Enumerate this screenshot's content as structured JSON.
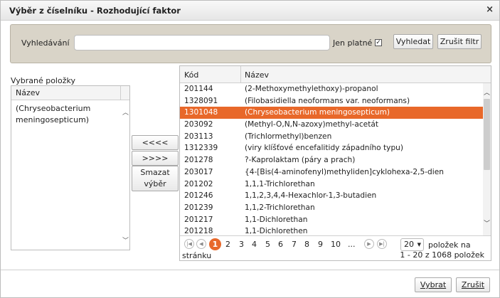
{
  "dialog": {
    "title": "Výběr z číselníku - Rozhodující faktor",
    "close_glyph": "×"
  },
  "search": {
    "label": "Vyhledávání",
    "value": "",
    "placeholder": "",
    "only_valid_label": "Jen platné",
    "only_valid_checked": true,
    "check_glyph": "✓",
    "search_button": "Vyhledat",
    "clear_button": "Zrušit filtr"
  },
  "selected": {
    "label": "Vybrané položky",
    "column_header": "Název",
    "items": [
      "(Chryseobacterium meningosepticum)"
    ]
  },
  "actions": {
    "add_all": "<<<<",
    "remove": ">>>>",
    "clear_selection_line1": "Smazat",
    "clear_selection_line2": "výběr"
  },
  "grid": {
    "columns": [
      "Kód",
      "Název"
    ],
    "selected_row_index": 2,
    "rows": [
      {
        "code": "201144",
        "name": "(2-Methoxymethylethoxy)-propanol"
      },
      {
        "code": "1328091",
        "name": "(Filobasidiella neoformans var. neoformans)"
      },
      {
        "code": "1301048",
        "name": "(Chryseobacterium meningosepticum)"
      },
      {
        "code": "203092",
        "name": "(Methyl-O,N,N-azoxy)methyl-acetát"
      },
      {
        "code": "203113",
        "name": "(Trichlormethyl)benzen"
      },
      {
        "code": "1312339",
        "name": "(viry klíšťové encefalitidy západního typu)"
      },
      {
        "code": "201278",
        "name": "?-Kaprolaktam (páry a prach)"
      },
      {
        "code": "203017",
        "name": "{4-[Bis(4-aminofenyl)methyliden]cyklohexa-2,5-dien"
      },
      {
        "code": "201202",
        "name": "1,1,1-Trichlorethan"
      },
      {
        "code": "201246",
        "name": "1,1,2,3,4,4-Hexachlor-1,3-butadien"
      },
      {
        "code": "201239",
        "name": "1,1,2-Trichlorethan"
      },
      {
        "code": "201217",
        "name": "1,1-Dichlorethan"
      },
      {
        "code": "201218",
        "name": "1,1-Dichlorethen"
      }
    ]
  },
  "pager": {
    "first_glyph": "|◀",
    "prev_glyph": "◀",
    "next_glyph": "▶",
    "last_glyph": "▶|",
    "current_page": "1",
    "pages": [
      "2",
      "3",
      "4",
      "5",
      "6",
      "7",
      "8",
      "9",
      "10"
    ],
    "ellipsis": "...",
    "page_size": "20",
    "page_size_arrow": "▼",
    "per_page_label": "položek na",
    "per_page_label2": "stránku",
    "info": "1 - 20 z 1068 položek"
  },
  "footer": {
    "select_button": "Vybrat",
    "cancel_button": "Zrušit"
  },
  "colors": {
    "accent": "#e8682a",
    "search_panel": "#d9d4c8"
  }
}
